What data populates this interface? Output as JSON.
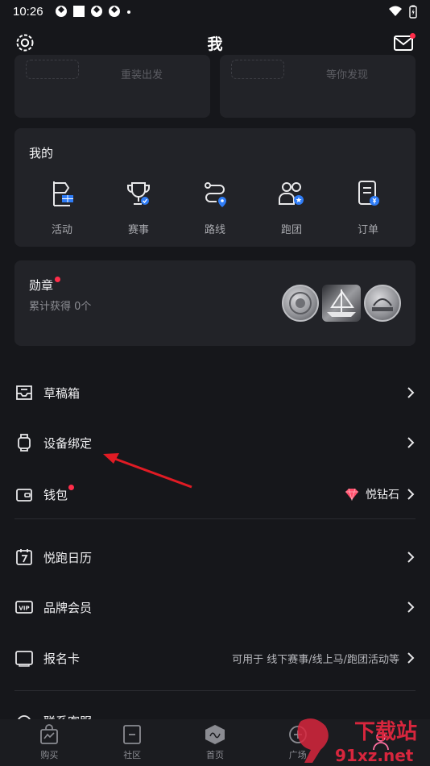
{
  "status": {
    "time": "10:26"
  },
  "header": {
    "title": "我"
  },
  "top_cards": {
    "left_text": "重装出发",
    "right_text": "等你发现"
  },
  "mine": {
    "title": "我的",
    "items": [
      {
        "label": "活动",
        "icon": "flag-icon"
      },
      {
        "label": "赛事",
        "icon": "trophy-icon"
      },
      {
        "label": "路线",
        "icon": "route-icon"
      },
      {
        "label": "跑团",
        "icon": "team-icon"
      },
      {
        "label": "订单",
        "icon": "order-icon"
      }
    ]
  },
  "medals": {
    "title": "勋章",
    "subtitle": "累计获得 0个"
  },
  "menu": [
    {
      "label": "草稿箱",
      "icon": "inbox-icon",
      "right": ""
    },
    {
      "label": "设备绑定",
      "icon": "watch-icon",
      "right": ""
    },
    {
      "label": "钱包",
      "icon": "wallet-icon",
      "right": "悦钻石"
    },
    {
      "label": "悦跑日历",
      "icon": "calendar-icon",
      "right": ""
    },
    {
      "label": "品牌会员",
      "icon": "vip-icon",
      "right": ""
    },
    {
      "label": "报名卡",
      "icon": "card-icon",
      "right": "可用于 线下赛事/线上马/跑团活动等"
    },
    {
      "label": "联系客服",
      "icon": "headset-icon",
      "right": ""
    }
  ],
  "vip_badge_text": "VIP",
  "tabs": [
    {
      "label": "购买",
      "icon": "shopping-bag-icon"
    },
    {
      "label": "社区",
      "icon": "community-icon"
    },
    {
      "label": "首页",
      "icon": "home-run-icon"
    },
    {
      "label": "广场",
      "icon": "plaza-icon"
    },
    {
      "label": "",
      "icon": "profile-icon"
    }
  ],
  "watermark": {
    "text1": "下载站",
    "text2": "91xz.net"
  },
  "colors": {
    "background": "#16171b",
    "card": "#222328",
    "accent_red": "#ff2d4a",
    "accent_blue": "#2f7cf6",
    "annotation_red": "#e01b24"
  }
}
